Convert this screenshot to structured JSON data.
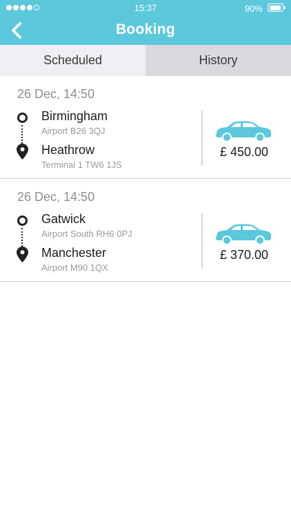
{
  "status_bar": {
    "time": "15:37",
    "battery_percent": "90%",
    "battery_level": 0.9,
    "signal_bars_filled": 4,
    "signal_bars_total": 5
  },
  "header": {
    "title": "Booking",
    "back_icon": "chevron-left-icon",
    "background_color": "#5bc8dc"
  },
  "tabs": [
    {
      "label": "Scheduled",
      "active": true
    },
    {
      "label": "History",
      "active": false
    }
  ],
  "bookings": [
    {
      "date": "26 Dec, 14:50",
      "from": {
        "name": "Birmingham",
        "detail": "Airport B26 3QJ"
      },
      "to": {
        "name": "Heathrow",
        "detail": "Terminal 1 TW6 1JS"
      },
      "price": "£ 450.00",
      "vehicle_icon": "car-icon"
    },
    {
      "date": "26 Dec, 14:50",
      "from": {
        "name": "Gatwick",
        "detail": "Airport South RH6 0PJ"
      },
      "to": {
        "name": "Manchester",
        "detail": "Airport M90 1QX"
      },
      "price": "£ 370.00",
      "vehicle_icon": "car-icon"
    }
  ],
  "colors": {
    "accent": "#5bc8dc",
    "car": "#5bc8dc"
  }
}
